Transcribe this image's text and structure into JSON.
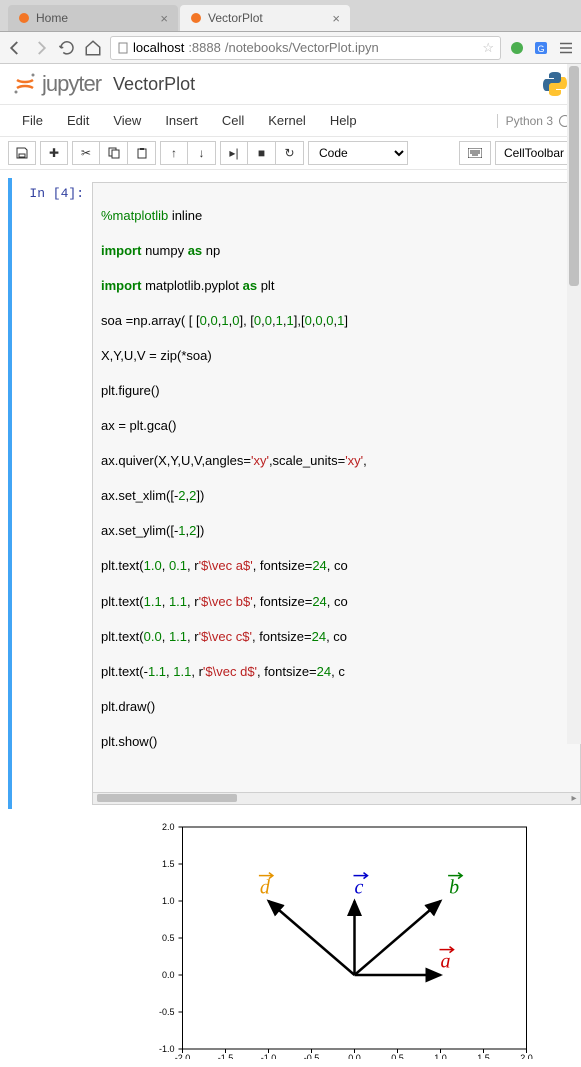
{
  "browser": {
    "tabs": [
      {
        "title": "Home",
        "active": false
      },
      {
        "title": "VectorPlot",
        "active": true
      }
    ],
    "url_host": "localhost",
    "url_port": ":8888",
    "url_path": "/notebooks/VectorPlot.ipyn"
  },
  "header": {
    "logo_text": "jupyter",
    "notebook_name": "VectorPlot"
  },
  "menubar": {
    "items": [
      "File",
      "Edit",
      "View",
      "Insert",
      "Cell",
      "Kernel",
      "Help"
    ],
    "kernel_name": "Python 3"
  },
  "toolbar": {
    "cell_type_selected": "Code",
    "cell_toolbar_label": "CellToolbar"
  },
  "cell": {
    "prompt": "In [4]:",
    "lines": {
      "l0_a": "%matplotlib",
      "l0_b": " inline",
      "l1_a": "import",
      "l1_b": " numpy ",
      "l1_c": "as",
      "l1_d": " np",
      "l2_a": "import",
      "l2_b": " matplotlib.pyplot ",
      "l2_c": "as",
      "l2_d": " plt",
      "l3_a": "soa =np.array( [ [",
      "l3_b": "0",
      "l3_c": ",",
      "l3_d": "0",
      "l3_e": ",",
      "l3_f": "1",
      "l3_g": ",",
      "l3_h": "0",
      "l3_i": "], [",
      "l3_j": "0",
      "l3_k": ",",
      "l3_l": "0",
      "l3_m": ",",
      "l3_n": "1",
      "l3_o": ",",
      "l3_p": "1",
      "l3_q": "],[",
      "l3_r": "0",
      "l3_s": ",",
      "l3_t": "0",
      "l3_u": ",",
      "l3_v": "0",
      "l3_w": ",",
      "l3_x": "1",
      "l3_y": "]",
      "l4": "X,Y,U,V = zip(*soa)",
      "l5": "plt.figure()",
      "l6": "ax = plt.gca()",
      "l7_a": "ax.quiver(X,Y,U,V,angles=",
      "l7_b": "'xy'",
      "l7_c": ",scale_units=",
      "l7_d": "'xy'",
      "l7_e": ",",
      "l8_a": "ax.set_xlim([-",
      "l8_b": "2",
      "l8_c": ",",
      "l8_d": "2",
      "l8_e": "])",
      "l9_a": "ax.set_ylim([-",
      "l9_b": "1",
      "l9_c": ",",
      "l9_d": "2",
      "l9_e": "])",
      "l10_a": "plt.text(",
      "l10_b": "1.0",
      "l10_c": ", ",
      "l10_d": "0.1",
      "l10_e": ", r",
      "l10_f": "'$\\vec a$'",
      "l10_g": ", fontsize=",
      "l10_h": "24",
      "l10_i": ", co",
      "l11_a": "plt.text(",
      "l11_b": "1.1",
      "l11_c": ", ",
      "l11_d": "1.1",
      "l11_e": ", r",
      "l11_f": "'$\\vec b$'",
      "l11_g": ", fontsize=",
      "l11_h": "24",
      "l11_i": ", co",
      "l12_a": "plt.text(",
      "l12_b": "0.0",
      "l12_c": ", ",
      "l12_d": "1.1",
      "l12_e": ", r",
      "l12_f": "'$\\vec c$'",
      "l12_g": ", fontsize=",
      "l12_h": "24",
      "l12_i": ", co",
      "l13_a": "plt.text(-",
      "l13_b": "1.1",
      "l13_c": ", ",
      "l13_d": "1.1",
      "l13_e": ", r",
      "l13_f": "'$\\vec d$'",
      "l13_g": ", fontsize=",
      "l13_h": "24",
      "l13_i": ", c",
      "l14": "plt.draw()",
      "l15": "plt.show()"
    }
  },
  "chart_data": {
    "type": "quiver",
    "title": "",
    "xlim": [
      -2,
      2
    ],
    "ylim": [
      -1,
      2
    ],
    "xticks": [
      -2.0,
      -1.5,
      -1.0,
      -0.5,
      0.0,
      0.5,
      1.0,
      1.5,
      2.0
    ],
    "yticks": [
      -1.0,
      -0.5,
      0.0,
      0.5,
      1.0,
      1.5,
      2.0
    ],
    "vectors": [
      {
        "x": 0,
        "y": 0,
        "u": 1,
        "v": 0
      },
      {
        "x": 0,
        "y": 0,
        "u": 1,
        "v": 1
      },
      {
        "x": 0,
        "y": 0,
        "u": 0,
        "v": 1
      },
      {
        "x": 0,
        "y": 0,
        "u": -1,
        "v": 1
      }
    ],
    "labels": [
      {
        "text": "a",
        "x": 1.0,
        "y": 0.1,
        "color": "#cc0000"
      },
      {
        "text": "b",
        "x": 1.1,
        "y": 1.1,
        "color": "#008000"
      },
      {
        "text": "c",
        "x": 0.0,
        "y": 1.1,
        "color": "#0000cc"
      },
      {
        "text": "d",
        "x": -1.1,
        "y": 1.1,
        "color": "#e59400"
      }
    ]
  }
}
